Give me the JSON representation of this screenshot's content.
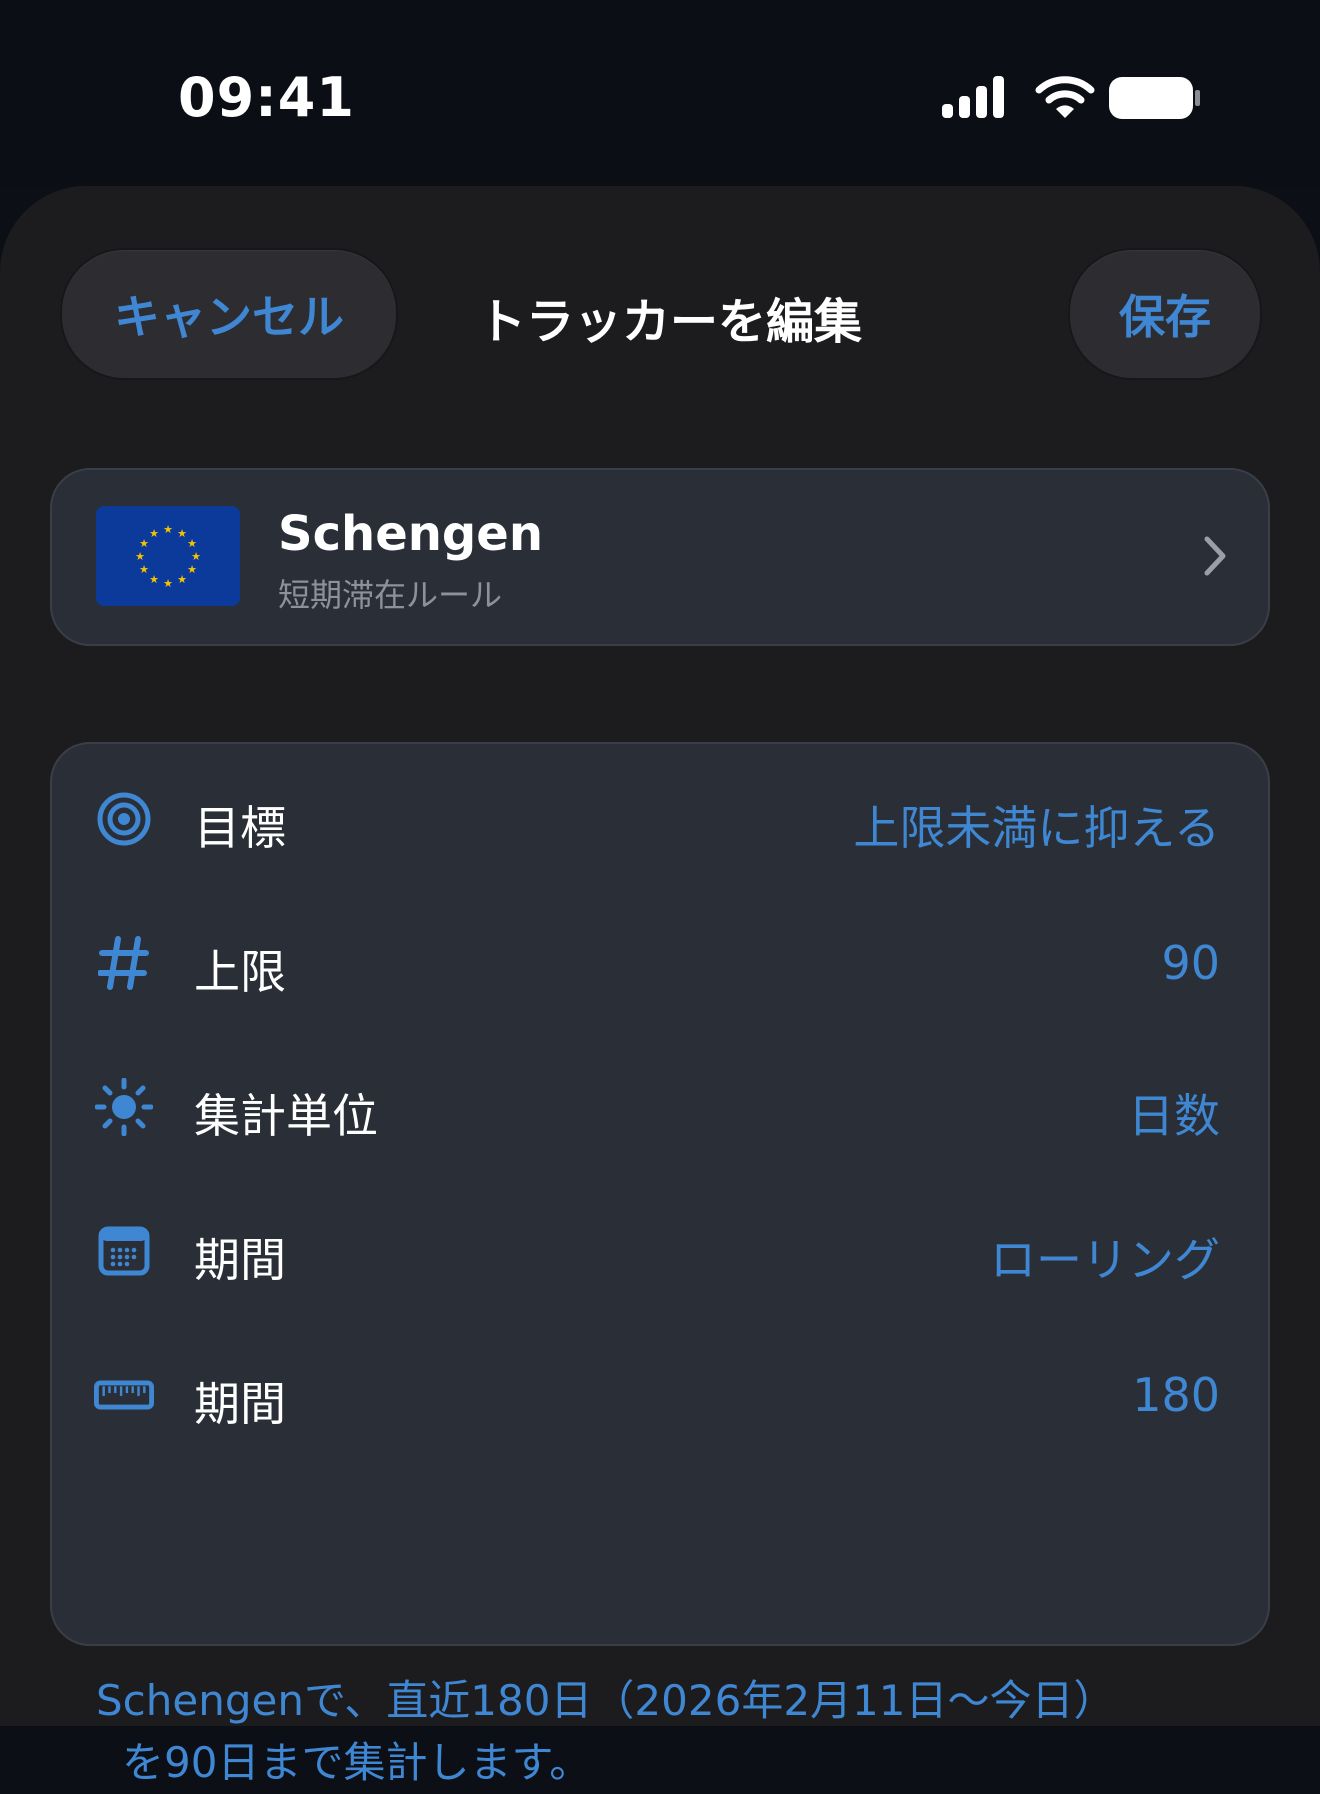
{
  "status_bar": {
    "time": "09:41"
  },
  "nav": {
    "cancel_label": "キャンセル",
    "title": "トラッカーを編集",
    "save_label": "保存"
  },
  "region": {
    "name": "Schengen",
    "subtitle": "短期滞在ルール",
    "flag_icon": "eu-flag-icon"
  },
  "settings": [
    {
      "icon": "target-icon",
      "label": "目標",
      "value": "上限未満に抑える"
    },
    {
      "icon": "hash-icon",
      "label": "上限",
      "value": "90"
    },
    {
      "icon": "sun-icon",
      "label": "集計単位",
      "value": "日数"
    },
    {
      "icon": "calendar-icon",
      "label": "期間",
      "value": "ローリング"
    },
    {
      "icon": "ruler-icon",
      "label": "期間",
      "value": "180"
    }
  ],
  "footer": {
    "line1": "Schengenで、直近180日（2026年2月11日〜今日）",
    "line2": "を90日まで集計します。"
  },
  "colors": {
    "accent": "#3f87d2",
    "background": "#1c1c1e",
    "card": "#2a2f37",
    "status_bar": "#0b0f15",
    "flag_blue": "#0b3a9b",
    "flag_star": "#f5c400"
  }
}
